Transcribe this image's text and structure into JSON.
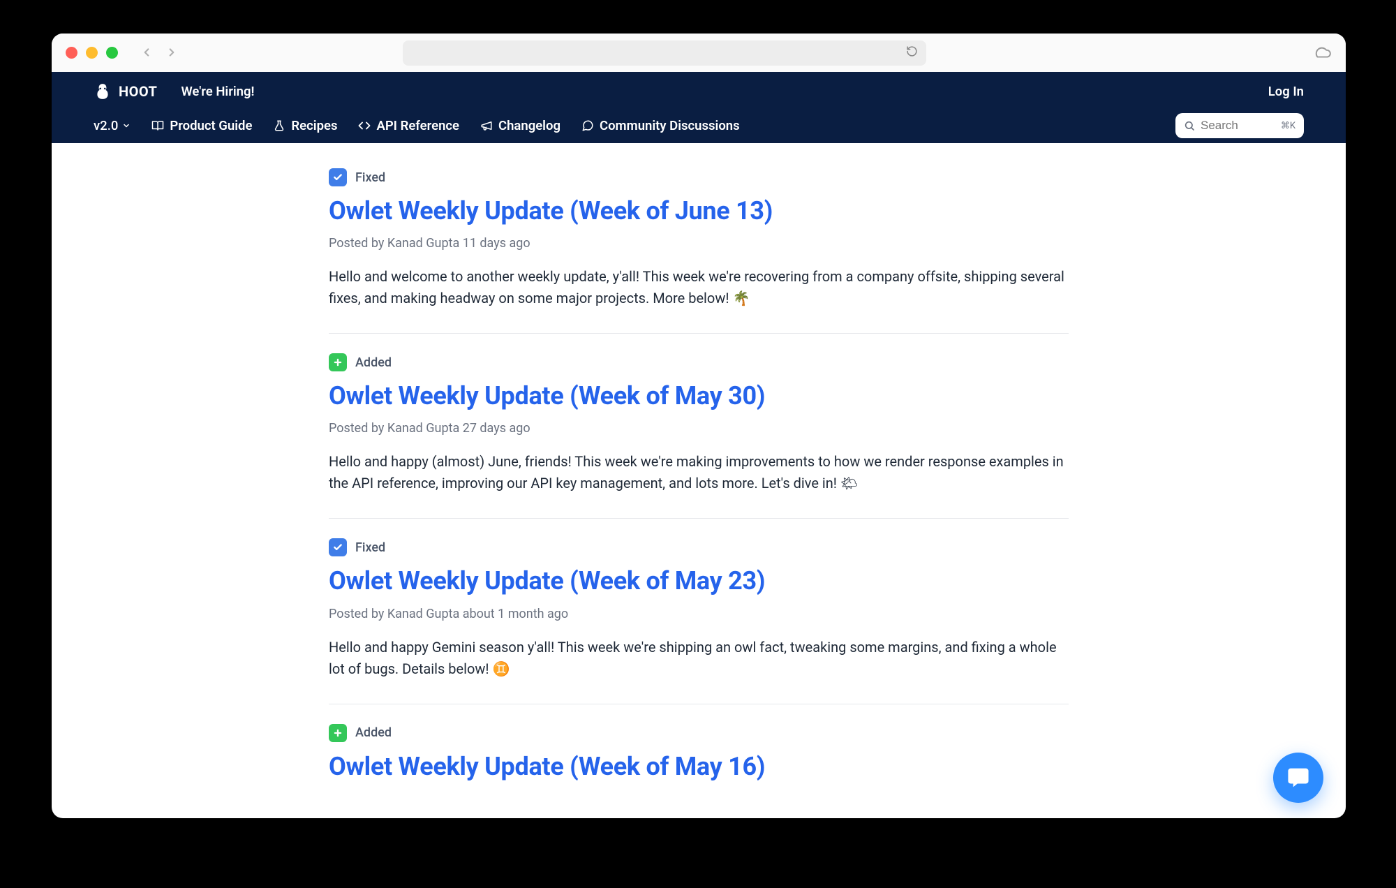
{
  "brand": {
    "name": "HOOT"
  },
  "header": {
    "hiring": "We're Hiring!",
    "login": "Log In",
    "version": "v2.0",
    "nav": [
      {
        "label": "Product Guide"
      },
      {
        "label": "Recipes"
      },
      {
        "label": "API Reference"
      },
      {
        "label": "Changelog"
      },
      {
        "label": "Community Discussions"
      }
    ],
    "search": {
      "placeholder": "Search",
      "shortcut": "⌘K"
    }
  },
  "badges": {
    "fixed": "Fixed",
    "added": "Added"
  },
  "posts": [
    {
      "badge": "fixed",
      "title": "Owlet Weekly Update (Week of June 13)",
      "meta": "Posted by Kanad Gupta 11 days ago",
      "excerpt": "Hello and welcome to another weekly update, y'all! This week we're recovering from a company offsite, shipping several fixes, and making headway on some major projects. More below! 🌴"
    },
    {
      "badge": "added",
      "title": "Owlet Weekly Update (Week of May 30)",
      "meta": "Posted by Kanad Gupta 27 days ago",
      "excerpt": "Hello and happy (almost) June, friends! This week we're making improvements to how we render response examples in the API reference, improving our API key management, and lots more. Let's dive in! 🌤"
    },
    {
      "badge": "fixed",
      "title": "Owlet Weekly Update (Week of May 23)",
      "meta": "Posted by Kanad Gupta about 1 month ago",
      "excerpt": "Hello and happy Gemini season y'all! This week we're shipping an owl fact, tweaking some margins, and fixing a whole lot of bugs. Details below! ♊"
    },
    {
      "badge": "added",
      "title": "Owlet Weekly Update (Week of May 16)",
      "meta": "",
      "excerpt": ""
    }
  ]
}
